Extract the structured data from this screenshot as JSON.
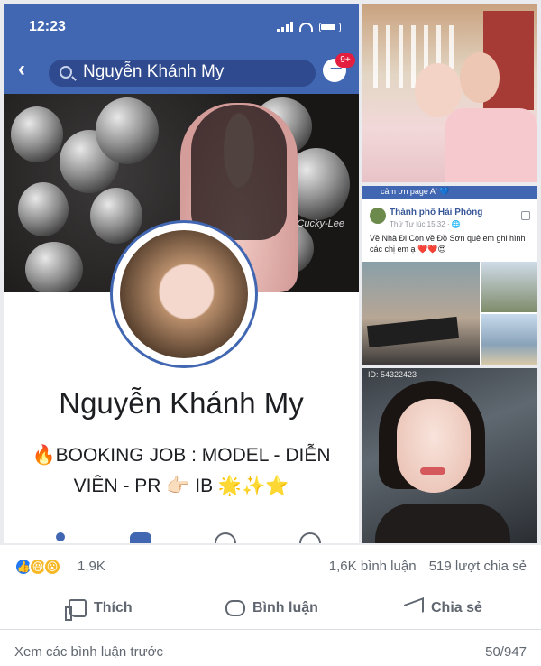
{
  "phone": {
    "time": "12:23",
    "search_query": "Nguyễn Khánh My",
    "messenger_badge": "9+",
    "cover_watermark": "Cucky-Lee",
    "profile_name": "Nguyễn Khánh My",
    "bio_line1": "🔥BOOKING JOB : MODEL - DIỄN",
    "bio_line2": "VIÊN - PR 👉🏻 IB 🌟✨⭐"
  },
  "tiles": {
    "post": {
      "header_strip": "cảm ơn page A' 💙",
      "location": "Thành phố Hải Phòng",
      "timestamp": "Thứ Tư lúc 15:32 · 🌐",
      "text": "Về Nhà Đi Con về Đồ Sơn quê em ghi hình các chị em ạ ❤️❤️😍"
    },
    "photo_id": "ID: 54322423"
  },
  "stats": {
    "reaction_count": "1,9K",
    "comments": "1,6K bình luận",
    "shares": "519 lượt chia sẻ"
  },
  "actions": {
    "like": "Thích",
    "comment": "Bình luận",
    "share": "Chia sẻ"
  },
  "footer": {
    "view_previous": "Xem các bình luận trước",
    "pager": "50/947"
  },
  "colors": {
    "facebook_blue": "#4267b2",
    "badge_red": "#e41e3f",
    "meta_gray": "#606770"
  },
  "icons": [
    "back-arrow-icon",
    "search-icon",
    "messenger-icon",
    "add-friend-icon",
    "message-icon",
    "more-icon",
    "like-reaction-icon",
    "haha-reaction-icon",
    "wow-reaction-icon",
    "thumbs-up-icon",
    "comment-icon",
    "share-icon"
  ]
}
